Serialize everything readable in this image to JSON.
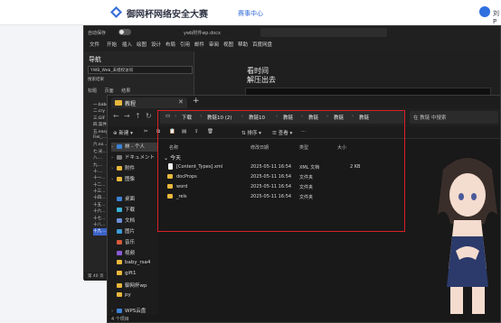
{
  "webheader": {
    "title": "御网杯网络安全大赛",
    "link": "赛事中心",
    "user": "刘P"
  },
  "word": {
    "autosave": "自动保存",
    "filename": "ywb附件wp.docx",
    "menu": [
      "文件",
      "开始",
      "插入",
      "绘图",
      "设计",
      "布局",
      "引用",
      "邮件",
      "审阅",
      "视图",
      "帮助",
      "百度网盘"
    ],
    "nav_title": "导航",
    "nav_search": "YWB_Web_未授权访问",
    "nav_search_result": "搜索结果",
    "nav_tabs": [
      "标题",
      "页面",
      "结果"
    ],
    "outline": [
      "一.babe",
      "二.cry",
      "三.GIF",
      "四.案件",
      "五.easy",
      "Fiel_…",
      "六.ez…",
      "七.光…",
      "八.…",
      "九.…",
      "十.…",
      "十一…",
      "十二…",
      "十三…",
      "十四…",
      "十五…",
      "十六…",
      "十七…",
      "十八…",
      "十九.…"
    ],
    "body_lines": [
      "看时间",
      "解压出去"
    ],
    "status": "第 40 页"
  },
  "explorer": {
    "tab_label": "教程",
    "breadcrumb": [
      "下载",
      "教链10 (2)",
      "教链10",
      "教链",
      "教链",
      "教链",
      "教链"
    ],
    "search_placeholder": "在 教链 中搜索",
    "commands": [
      "新建",
      "排序",
      "查看"
    ],
    "sidebar": [
      {
        "label": "林 - 个人",
        "color": "#3b82d6"
      },
      {
        "label": "ドキュメント",
        "color": "#7a7a7a"
      },
      {
        "label": "附件",
        "color": "#e8b83c"
      },
      {
        "label": "图像",
        "color": "#e8b83c"
      },
      {
        "label": "桌面",
        "color": "#3b82d6"
      },
      {
        "label": "下载",
        "color": "#3bb0d6"
      },
      {
        "label": "文档",
        "color": "#6b8fd6"
      },
      {
        "label": "图片",
        "color": "#3b9bd6"
      },
      {
        "label": "音乐",
        "color": "#d65a3b"
      },
      {
        "label": "视频",
        "color": "#8a5ad6"
      },
      {
        "label": "baby_rsa4",
        "color": "#e8b83c"
      },
      {
        "label": "gift1",
        "color": "#e8b83c"
      },
      {
        "label": "御网杯wp",
        "color": "#e8b83c"
      },
      {
        "label": "py",
        "color": "#e8b83c"
      },
      {
        "label": "WPS云盘",
        "color": "#3b82d6"
      }
    ],
    "columns": [
      "名称",
      "修改日期",
      "类型",
      "大小"
    ],
    "group": "今天",
    "files": [
      {
        "name": "[Content_Types].xml",
        "date": "2025-05-11 16:54",
        "type": "XML 文档",
        "size": "2 KB",
        "kind": "doc"
      },
      {
        "name": "docProps",
        "date": "2025-05-11 16:54",
        "type": "文件夹",
        "size": "",
        "kind": "folder"
      },
      {
        "name": "word",
        "date": "2025-05-11 16:54",
        "type": "文件夹",
        "size": "",
        "kind": "folder"
      },
      {
        "name": "_rels",
        "date": "2025-05-11 16:54",
        "type": "文件夹",
        "size": "",
        "kind": "folder"
      }
    ],
    "status": "4 个项目"
  }
}
